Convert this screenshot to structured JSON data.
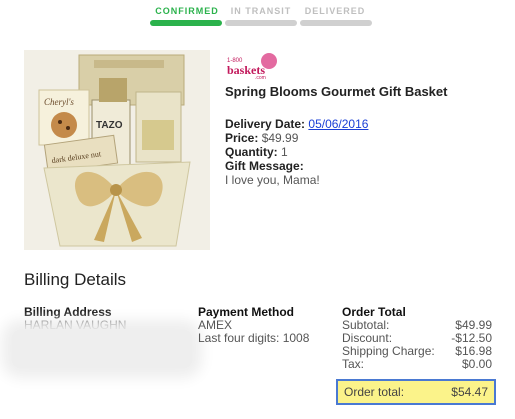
{
  "progress": {
    "steps": [
      {
        "label": "CONFIRMED",
        "active": true
      },
      {
        "label": "IN TRANSIT",
        "active": false
      },
      {
        "label": "DELIVERED",
        "active": false
      }
    ]
  },
  "product": {
    "brand_logo": "1-800 baskets.com",
    "image_text": {
      "box_label": "dark deluxe nut",
      "tea_label": "TAZO",
      "cookie_label": "Cheryl's"
    },
    "name": "Spring Blooms Gourmet Gift Basket",
    "delivery_date_label": "Delivery Date:",
    "delivery_date": "05/06/2016",
    "price_label": "Price:",
    "price": "$49.99",
    "quantity_label": "Quantity:",
    "quantity": "1",
    "gift_message_label": "Gift Message:",
    "gift_message": "I love you, Mama!"
  },
  "billing": {
    "title": "Billing Details",
    "address_label": "Billing Address",
    "address_name": "HARLAN VAUGHN",
    "payment_label": "Payment Method",
    "payment_type": "AMEX",
    "payment_digits": "Last four digits: 1008",
    "order_total_label": "Order Total",
    "lines": [
      {
        "label": "Subtotal:",
        "value": "$49.99"
      },
      {
        "label": "Discount:",
        "value": "-$12.50"
      },
      {
        "label": "Shipping Charge:",
        "value": "$16.98"
      },
      {
        "label": "Tax:",
        "value": "$0.00"
      }
    ],
    "grand_label": "Order total:",
    "grand_value": "$54.47"
  },
  "colors": {
    "accent_green": "#2bb24c",
    "highlight_yellow": "#fbf38a",
    "highlight_border": "#4a79d2",
    "link_blue": "#1a3fd6",
    "brand_pink": "#c2185b"
  }
}
